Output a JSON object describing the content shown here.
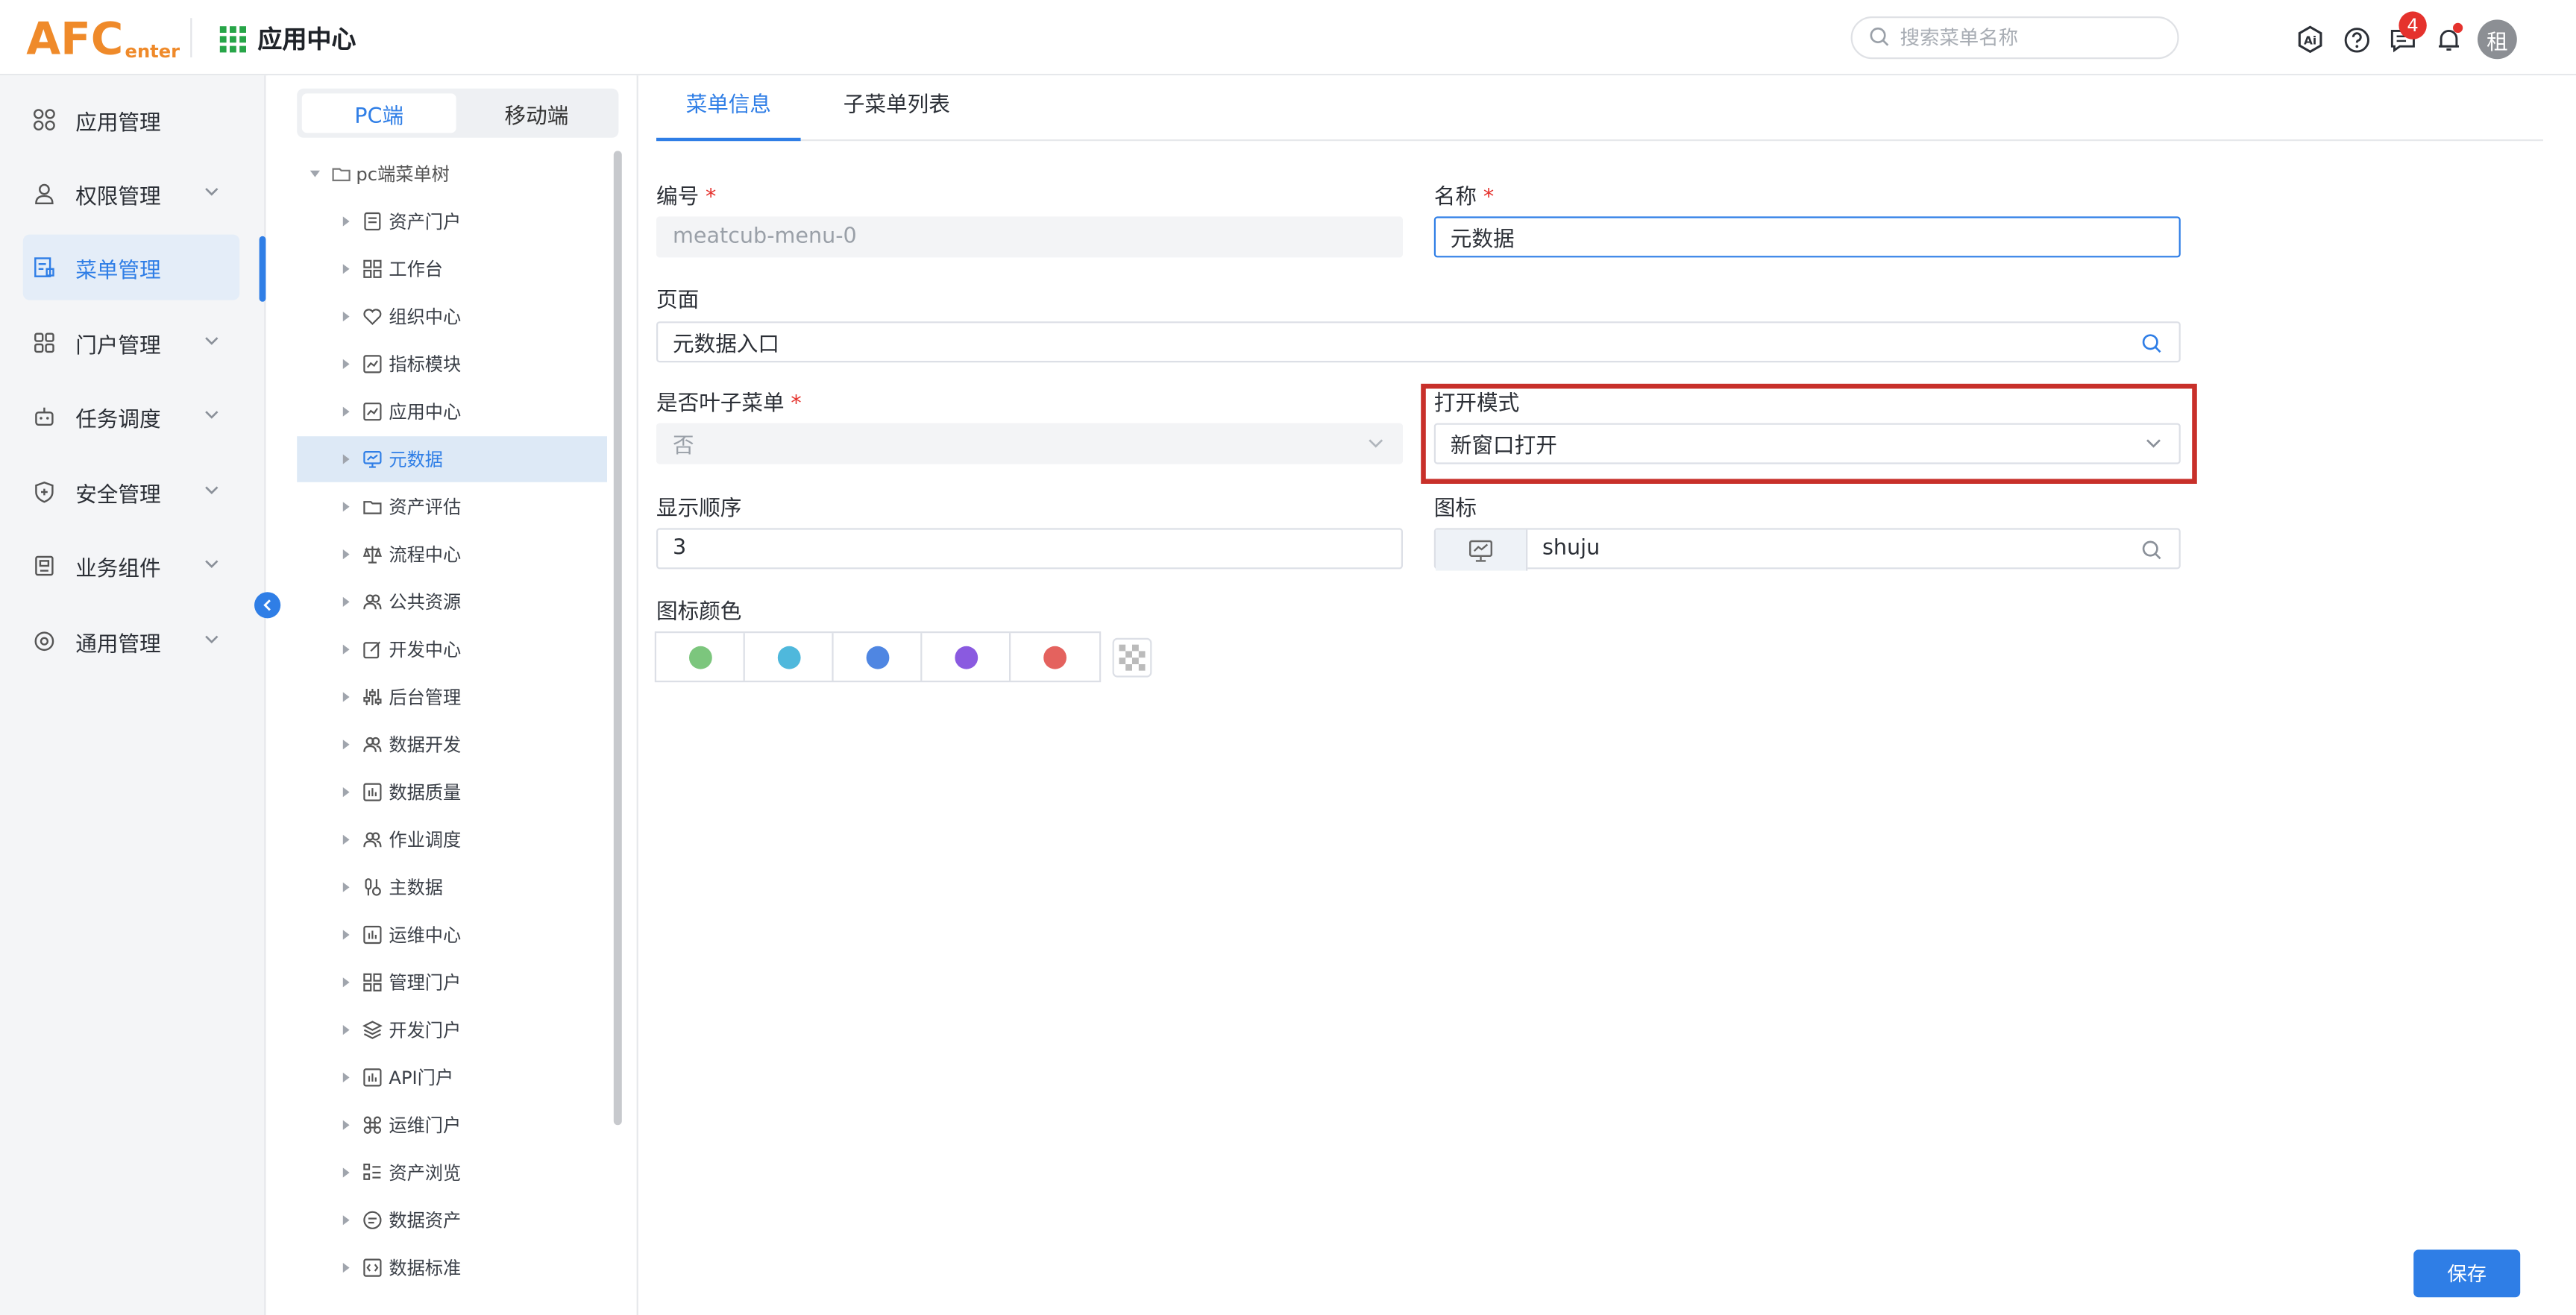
{
  "header": {
    "logo_main": "AFC",
    "logo_sub": "enter",
    "app_title": "应用中心",
    "search_placeholder": "搜索菜单名称",
    "ai_icon_text": "Ai",
    "notification_count": "4",
    "avatar_text": "租"
  },
  "leftnav": {
    "items": [
      {
        "label": "应用管理",
        "icon": "apps-icon"
      },
      {
        "label": "权限管理",
        "icon": "user-lock-icon"
      },
      {
        "label": "菜单管理",
        "icon": "menu-icon"
      },
      {
        "label": "门户管理",
        "icon": "grid-icon"
      },
      {
        "label": "任务调度",
        "icon": "robot-icon"
      },
      {
        "label": "安全管理",
        "icon": "shield-icon"
      },
      {
        "label": "业务组件",
        "icon": "component-icon"
      },
      {
        "label": "通用管理",
        "icon": "settings-icon"
      }
    ],
    "active_index": 2
  },
  "tree": {
    "tabs": [
      "PC端",
      "移动端"
    ],
    "root_label": "pc端菜单树",
    "items": [
      {
        "label": "资产门户",
        "icon": "document-icon"
      },
      {
        "label": "工作台",
        "icon": "grid-icon"
      },
      {
        "label": "组织中心",
        "icon": "heart-icon"
      },
      {
        "label": "指标模块",
        "icon": "chart-icon"
      },
      {
        "label": "应用中心",
        "icon": "chart-icon"
      },
      {
        "label": "元数据",
        "icon": "monitor-icon"
      },
      {
        "label": "资产评估",
        "icon": "folder-icon"
      },
      {
        "label": "流程中心",
        "icon": "scale-icon"
      },
      {
        "label": "公共资源",
        "icon": "users-icon"
      },
      {
        "label": "开发中心",
        "icon": "edit-icon"
      },
      {
        "label": "后台管理",
        "icon": "sliders-icon"
      },
      {
        "label": "数据开发",
        "icon": "users-icon"
      },
      {
        "label": "数据质量",
        "icon": "bar-chart-icon"
      },
      {
        "label": "作业调度",
        "icon": "users-icon"
      },
      {
        "label": "主数据",
        "icon": "tools-icon"
      },
      {
        "label": "运维中心",
        "icon": "bar-chart-icon"
      },
      {
        "label": "管理门户",
        "icon": "grid-icon"
      },
      {
        "label": "开发门户",
        "icon": "layers-icon"
      },
      {
        "label": "API门户",
        "icon": "bar-chart-icon"
      },
      {
        "label": "运维门户",
        "icon": "command-icon"
      },
      {
        "label": "资产浏览",
        "icon": "list-icon"
      },
      {
        "label": "数据资产",
        "icon": "message-icon"
      },
      {
        "label": "数据标准",
        "icon": "code-icon"
      }
    ],
    "selected_index": 5
  },
  "main": {
    "tabs": [
      "菜单信息",
      "子菜单列表"
    ],
    "form": {
      "code_label": "编号",
      "code_value": "meatcub-menu-0",
      "name_label": "名称",
      "name_value": "元数据",
      "page_label": "页面",
      "page_value": "元数据入口",
      "leaf_label": "是否叶子菜单",
      "leaf_value": "否",
      "open_mode_label": "打开模式",
      "open_mode_value": "新窗口打开",
      "order_label": "显示顺序",
      "order_value": "3",
      "icon_label": "图标",
      "icon_value": "shuju",
      "color_label": "图标颜色",
      "required_mark": "*"
    },
    "colors": [
      "#7cc67d",
      "#4fb8dc",
      "#4f86e2",
      "#8a5ae0",
      "#e4625e"
    ],
    "save_label": "保存"
  }
}
